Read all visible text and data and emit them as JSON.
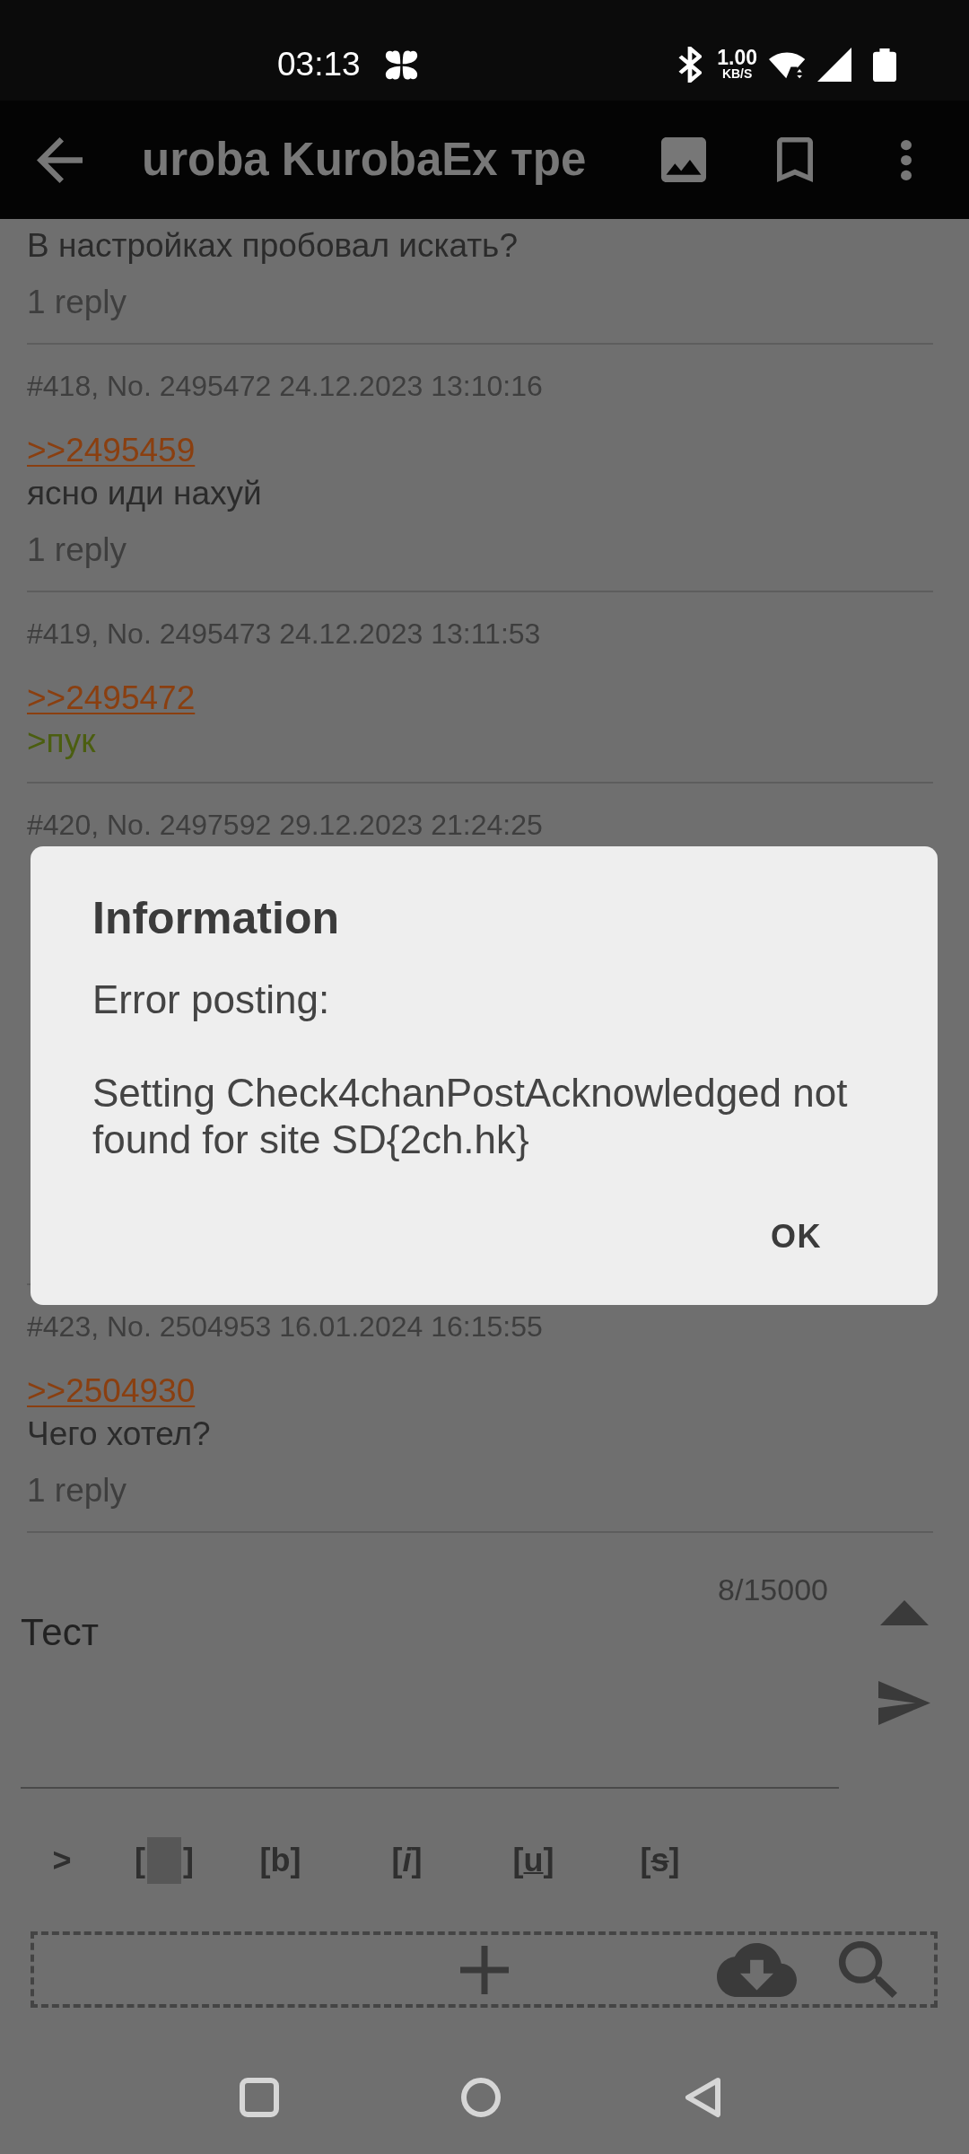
{
  "status_bar": {
    "time": "03:13",
    "net_speed": "1.00",
    "net_speed_unit": "KB/S"
  },
  "toolbar": {
    "title": "uroba KurobaEx тре"
  },
  "posts": [
    {
      "lines": [
        {
          "kind": "text",
          "text": "В настройках пробовал искать?"
        }
      ],
      "replies": "1 reply"
    },
    {
      "header": "#418, No. 2495472 24.12.2023 13:10:16",
      "lines": [
        {
          "kind": "quote_link",
          "text": ">>2495459"
        },
        {
          "kind": "text",
          "text": "ясно иди нахуй"
        }
      ],
      "replies": "1 reply"
    },
    {
      "header": "#419, No. 2495473 24.12.2023 13:11:53",
      "lines": [
        {
          "kind": "quote_link",
          "text": ">>2495472"
        },
        {
          "kind": "greentext",
          "text": ">пук"
        }
      ]
    },
    {
      "header": "#420, No. 2497592 29.12.2023 21:24:25"
    },
    {
      "header": "#423, No. 2504953 16.01.2024 16:15:55",
      "lines": [
        {
          "kind": "quote_link",
          "text": ">>2504930"
        },
        {
          "kind": "text",
          "text": "Чего хотел?"
        }
      ],
      "replies": "1 reply"
    }
  ],
  "dialog": {
    "title": "Information",
    "message": [
      "Error posting:",
      "Setting Check4chanPostAcknowledged not found for site SD{2ch.hk}"
    ],
    "buttons": [
      "OK"
    ]
  },
  "reply_form": {
    "char_count": "8/15000",
    "value": "Тест",
    "format_buttons": [
      {
        "kind": "plain",
        "label": ">"
      },
      {
        "kind": "spoiler",
        "open": "[",
        "close": "]"
      },
      {
        "kind": "bold",
        "open": "[",
        "inner": "b",
        "close": "]"
      },
      {
        "kind": "italic",
        "open": "[",
        "inner": "i",
        "close": "]"
      },
      {
        "kind": "underline",
        "open": "[",
        "inner": "u",
        "close": "]"
      },
      {
        "kind": "strike",
        "open": "[",
        "inner": "s",
        "close": "]"
      }
    ]
  }
}
